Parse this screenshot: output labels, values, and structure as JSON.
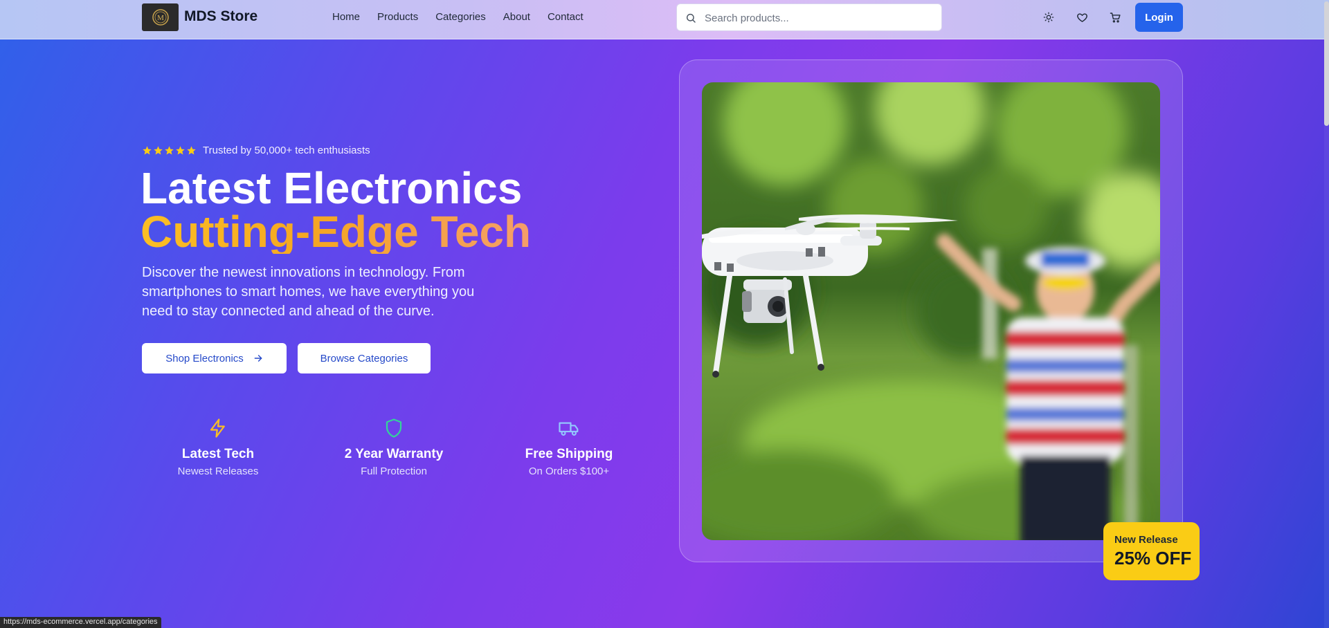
{
  "header": {
    "brand": "MDS Store",
    "logo_text": "M",
    "nav": [
      "Home",
      "Products",
      "Categories",
      "About",
      "Contact"
    ],
    "search_placeholder": "Search products...",
    "icons": [
      "sun-icon",
      "heart-icon",
      "cart-icon"
    ],
    "login_label": "Login"
  },
  "hero": {
    "rating_stars": 5,
    "rating_text": "Trusted by 50,000+ tech enthusiasts",
    "headline": "Latest Electronics",
    "headline_accent": "Cutting-Edge Tech",
    "description": "Discover the newest innovations in technology. From smartphones to smart homes, we have everything you need to stay connected and ahead of the curve.",
    "primary_cta": "Shop Electronics",
    "secondary_cta": "Browse Categories",
    "features": [
      {
        "icon": "lightning-icon",
        "title": "Latest Tech",
        "subtitle": "Newest Releases"
      },
      {
        "icon": "shield-icon",
        "title": "2 Year Warranty",
        "subtitle": "Full Protection"
      },
      {
        "icon": "truck-icon",
        "title": "Free Shipping",
        "subtitle": "On Orders $100+"
      }
    ],
    "promo": {
      "label": "New Release",
      "value": "25% OFF"
    }
  },
  "status_bar_url": "https://mds-ecommerce.vercel.app/categories",
  "colors": {
    "accent": "#2563eb",
    "headline_accent": "#fbbf24",
    "promo_badge": "#facc15",
    "star": "#facc15"
  }
}
